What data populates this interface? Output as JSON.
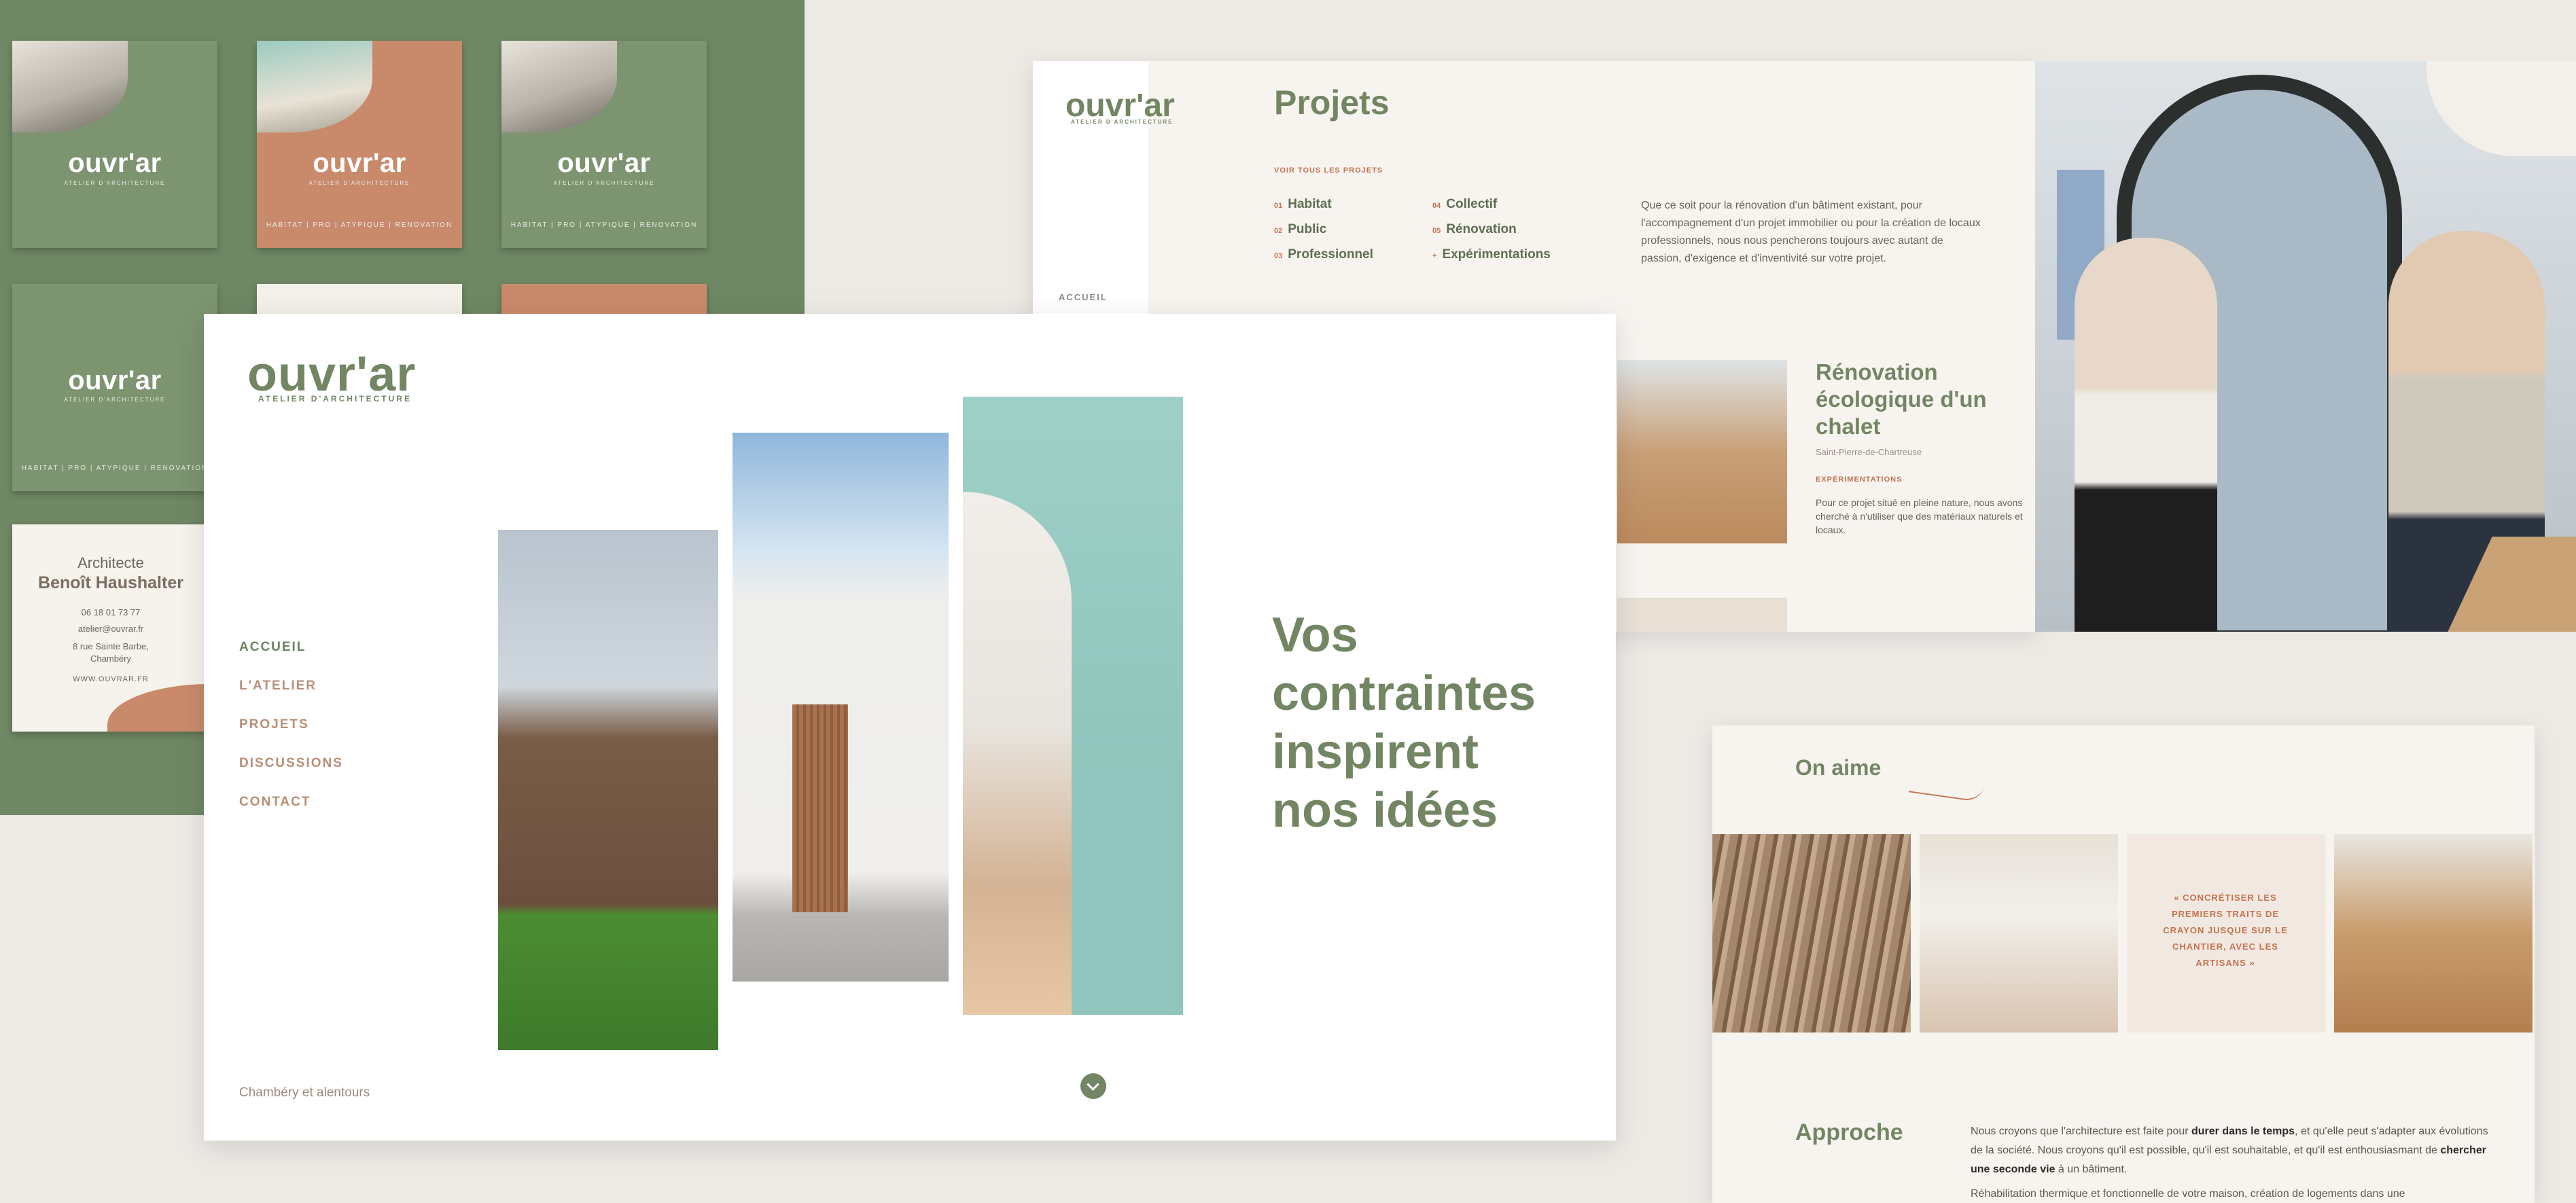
{
  "brand": {
    "name": "ouvr'ar",
    "tagline": "ATELIER D'ARCHITECTURE",
    "card_tags": "HABITAT | PRO | ATYPIQUE | RENOVATION"
  },
  "business_card": {
    "role": "Architecte",
    "name": "Benoît Haushalter",
    "phone": "06 18 01 73 77",
    "email": "atelier@ouvrar.fr",
    "address_line1": "8 rue Sainte Barbe,",
    "address_line2": "Chambéry",
    "website": "WWW.OUVRAR.FR"
  },
  "hero": {
    "nav": [
      "ACCUEIL",
      "L'ATELIER",
      "PROJETS",
      "DISCUSSIONS",
      "CONTACT"
    ],
    "headline": [
      "Vos",
      "contraintes",
      "inspirent",
      "nos idées"
    ],
    "location": "Chambéry et alentours"
  },
  "projects": {
    "title": "Projets",
    "see_all": "VOIR TOUS LES PROJETS",
    "categories": [
      {
        "num": "01",
        "label": "Habitat"
      },
      {
        "num": "02",
        "label": "Public"
      },
      {
        "num": "03",
        "label": "Professionnel"
      },
      {
        "num": "04",
        "label": "Collectif"
      },
      {
        "num": "05",
        "label": "Rénovation"
      },
      {
        "num": "+",
        "label": "Expérimentations"
      }
    ],
    "intro": "Que ce soit pour la rénovation d'un bâtiment existant, pour l'accompagnement d'un projet immobilier ou pour la création de locaux professionnels, nous nous pencherons toujours avec autant de passion, d'exigence et d'inventivité sur votre projet.",
    "breadcrumb": "ACCUEIL",
    "featured": {
      "title": "Rénovation écologique d'un chalet",
      "location": "Saint-Pierre-de-Chartreuse",
      "category": "EXPÉRIMENTATIONS",
      "description": "Pour ce projet situé en pleine nature, nous avons cherché à n'utiliser que des matériaux naturels et locaux."
    }
  },
  "about": {
    "on_aime": "On aime",
    "quote": "« CONCRÉTISER LES PREMIERS TRAITS DE CRAYON JUSQUE SUR LE CHANTIER, AVEC LES ARTISANS »",
    "approche_title": "Approche",
    "para1_a": "Nous croyons que l'architecture est faite pour ",
    "para1_b": "durer dans le temps",
    "para1_c": ", et qu'elle peut s'adapter aux évolutions de la société. Nous croyons qu'il est possible, qu'il est souhaitable, et qu'il est enthousiasmant de ",
    "para1_d": "chercher une seconde vie",
    "para1_e": " à un bâtiment.",
    "para2": "Réhabilitation thermique et fonctionnelle de votre maison, création de logements dans une"
  },
  "colors": {
    "sage": "#738663",
    "terracotta": "#c4734f",
    "board_green": "#6f8864",
    "background": "#ede9e5"
  }
}
